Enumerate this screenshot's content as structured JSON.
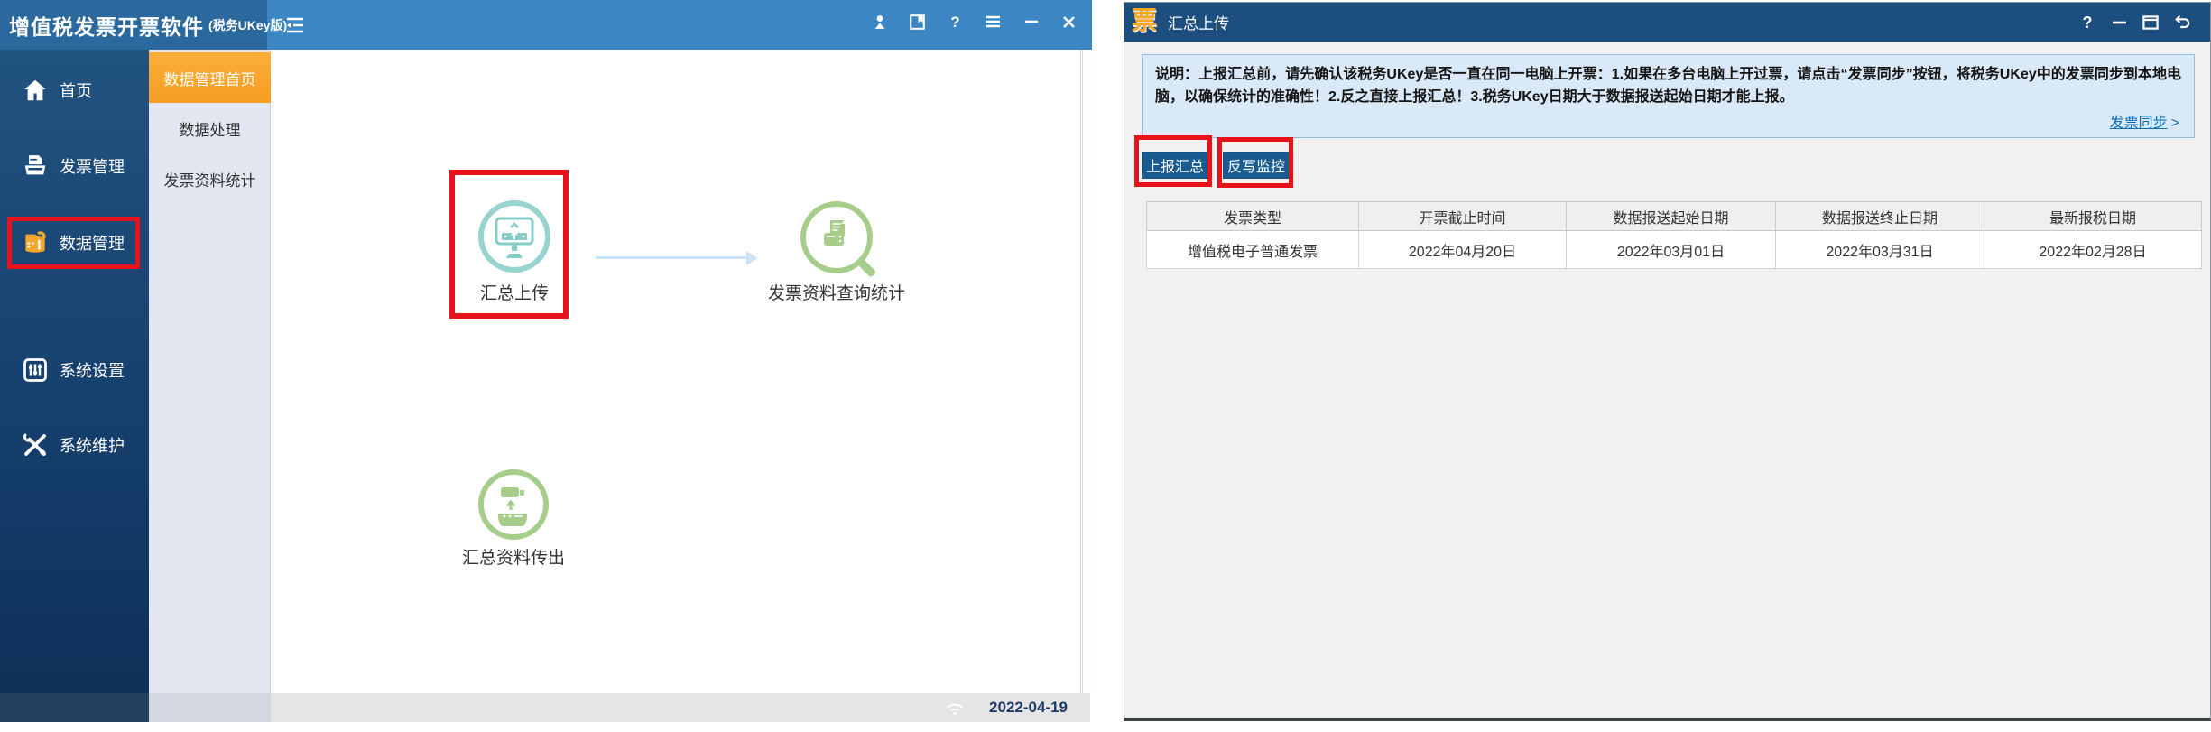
{
  "app": {
    "title": "增值税发票开票软件",
    "subtitle": "(税务UKey版)"
  },
  "left_window": {
    "titlebar_icons": [
      "collapse-icon",
      "user-icon",
      "bookmark-icon",
      "help-icon",
      "menu-icon",
      "minimize-icon",
      "close-icon"
    ],
    "help_glyph": "?",
    "sidebar": {
      "items": [
        {
          "label": "首页",
          "icon": "home-icon"
        },
        {
          "label": "发票管理",
          "icon": "invoice-printer-icon"
        },
        {
          "label": "数据管理",
          "icon": "data-folder-icon",
          "highlighted": true
        },
        {
          "label": "系统设置",
          "icon": "sliders-icon"
        },
        {
          "label": "系统维护",
          "icon": "tools-icon"
        }
      ]
    },
    "submenu": {
      "items": [
        {
          "label": "数据管理首页",
          "active": true
        },
        {
          "label": "数据处理",
          "active": false
        },
        {
          "label": "发票资料统计",
          "active": false
        }
      ]
    },
    "nodes": [
      {
        "label": "汇总上传",
        "icon": "monitor-upload-icon",
        "highlighted": true
      },
      {
        "label": "发票资料查询统计",
        "icon": "search-documents-icon"
      },
      {
        "label": "汇总资料传出",
        "icon": "export-device-icon"
      }
    ],
    "statusbar": {
      "date": "2022-04-19",
      "icon": "wifi-icon"
    }
  },
  "right_window": {
    "titlebar": {
      "logo": "票",
      "title": "汇总上传",
      "help_glyph": "?",
      "controls": [
        "help-icon",
        "minimize-icon",
        "maximize-icon",
        "back-icon"
      ]
    },
    "notice": {
      "text": "说明：上报汇总前，请先确认该税务UKey是否一直在同一电脑上开票：1.如果在多台电脑上开过票，请点击“发票同步”按钮，将税务UKey中的发票同步到本地电脑，以确保统计的准确性！2.反之直接上报汇总！3.税务UKey日期大于数据报送起始日期才能上报。",
      "link_label": "发票同步",
      "link_arrow": ">"
    },
    "buttons": {
      "report": "上报汇总",
      "monitor": "反写监控"
    },
    "table": {
      "headers": [
        "发票类型",
        "开票截止时间",
        "数据报送起始日期",
        "数据报送终止日期",
        "最新报税日期"
      ],
      "rows": [
        [
          "增值税电子普通发票",
          "2022年04月20日",
          "2022年03月01日",
          "2022年03月31日",
          "2022年02月28日"
        ]
      ]
    }
  },
  "colors": {
    "left_titlebar_dark": "#2b689e",
    "left_titlebar_light": "#3b86c3",
    "sidebar_navy": "#16406e",
    "active_orange": "#f6a62a",
    "right_titlebar": "#1d4e80",
    "button_blue": "#1a5c90",
    "notice_bg": "#d9e9f8",
    "link_blue": "#0a6ebd",
    "highlight_red": "#e8121a",
    "teal_icon": "#97d3cf",
    "green_icon": "#a6ce8a"
  }
}
